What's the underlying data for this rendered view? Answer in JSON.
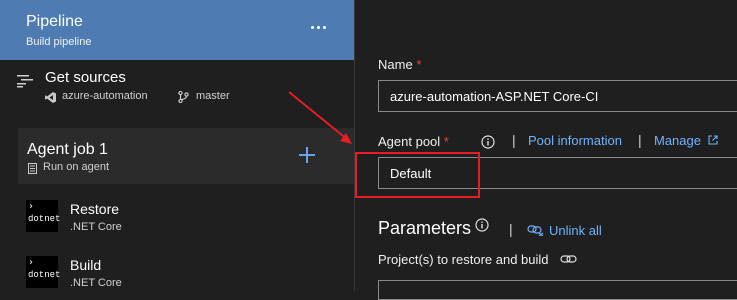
{
  "pipeline": {
    "title": "Pipeline",
    "subtitle": "Build pipeline"
  },
  "get_sources": {
    "title": "Get sources",
    "repo": "azure-automation",
    "branch": "master"
  },
  "agent_job": {
    "title": "Agent job 1",
    "subtitle": "Run on agent"
  },
  "tasks": [
    {
      "name": "Restore",
      "subtitle": ".NET Core",
      "icon_text": "dotnet"
    },
    {
      "name": "Build",
      "subtitle": ".NET Core",
      "icon_text": "dotnet"
    }
  ],
  "form": {
    "name_label": "Name",
    "required_mark": "*",
    "name_value": "azure-automation-ASP.NET Core-CI",
    "agent_pool_label": "Agent pool",
    "pool_information_link": "Pool information",
    "manage_link": "Manage",
    "agent_pool_value": "Default",
    "separator": "|",
    "parameters_title": "Parameters",
    "unlink_all_link": "Unlink all",
    "projects_label": "Project(s) to restore and build"
  },
  "colors": {
    "header_blue": "#4f7bb3",
    "link_blue": "#6fb3ff",
    "required_red": "#e8473d",
    "annotation_red": "#e81c24"
  },
  "icons": {
    "more": "more-horizontal-icon",
    "sources": "get-sources-icon",
    "repo": "visual-studio-repo-icon",
    "branch": "branch-icon",
    "agent": "server-agent-icon",
    "add": "plus-icon",
    "info": "info-icon",
    "external": "external-link-icon",
    "unlink": "unlink-icon",
    "link": "link-icon"
  }
}
